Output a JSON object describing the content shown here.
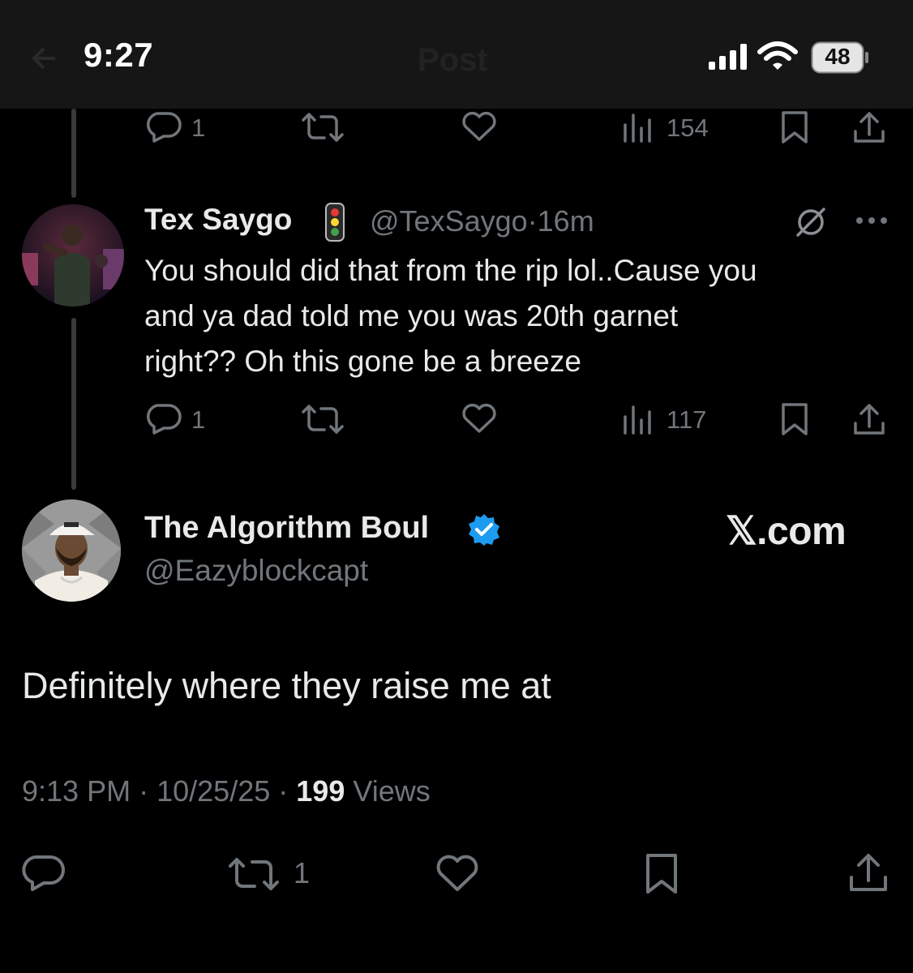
{
  "status_bar": {
    "time": "9:27",
    "battery": "48",
    "icons": [
      "signal-icon",
      "wifi-icon",
      "battery-icon"
    ]
  },
  "header": {
    "title": "Post"
  },
  "prev_tweet_actions": {
    "replies": "1",
    "views": "154"
  },
  "reply_tweet": {
    "name": "Tex Saygo",
    "emoji": "traffic-light-emoji",
    "handle": "@TexSaygo",
    "separator": "·",
    "time": "16m",
    "text_lines": [
      "You should did that from the rip lol..Cause you",
      "and ya dad told me you was 20th garnet",
      "right?? Oh this gone be a breeze"
    ],
    "replies": "1",
    "views": "117"
  },
  "main_tweet": {
    "name": "The Algorithm Boul",
    "handle": "@Eazyblockcapt",
    "brand": "𝕏.com",
    "text": "Definitely where they raise me at",
    "time": "9:13 PM",
    "date": "10/25/25",
    "separator": "·",
    "views_count": "199",
    "views_label": "Views",
    "reposts": "1"
  },
  "colors": {
    "background": "#000000",
    "text": "#e7e9ea",
    "muted": "#71767b",
    "verified": "#1d9bf0"
  }
}
